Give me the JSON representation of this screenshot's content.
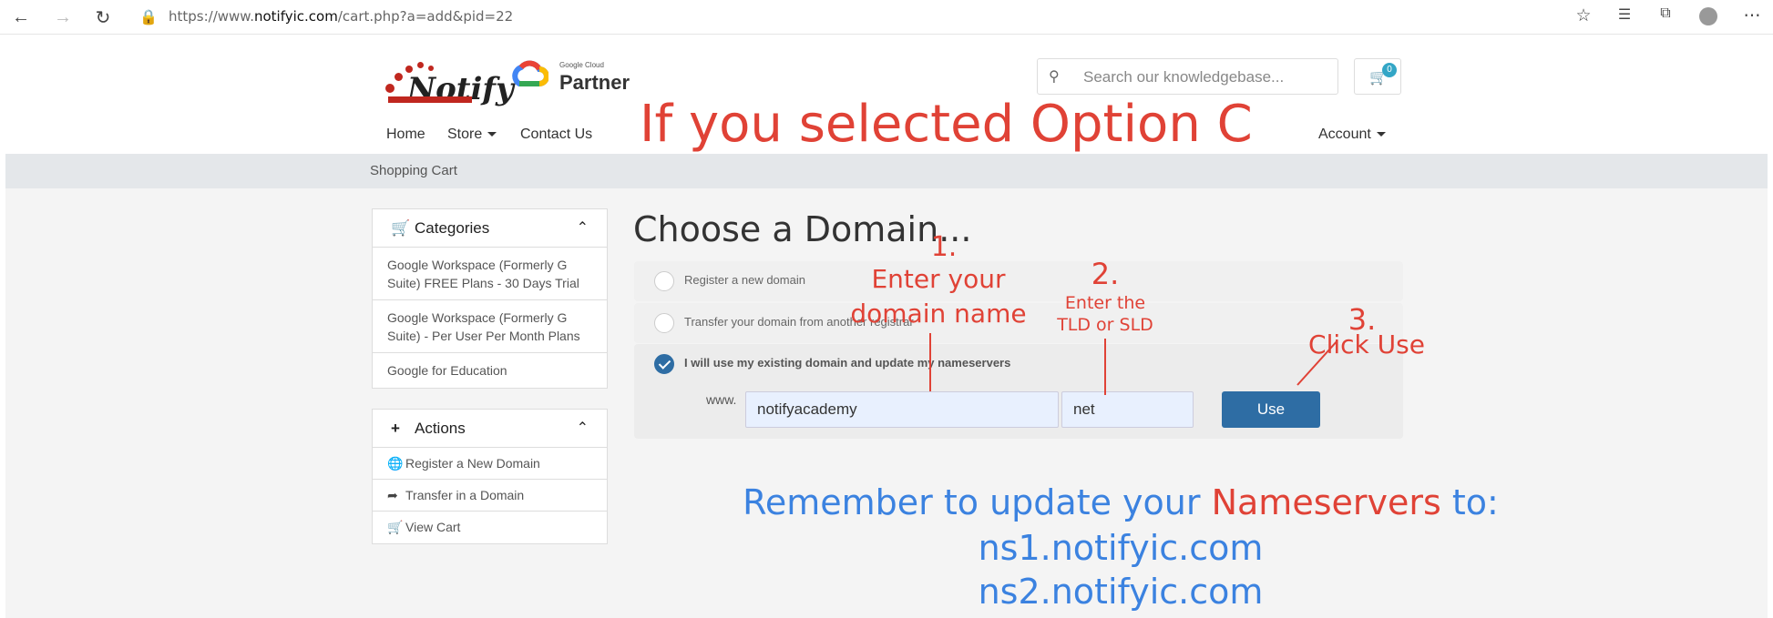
{
  "browser": {
    "url_prefix": "https://www.",
    "url_host": "notifyic.com",
    "url_path": "/cart.php?a=add&pid=22"
  },
  "header": {
    "logo_text": "Notify",
    "google_cloud_label": "Google Cloud",
    "partner_label": "Partner",
    "search_placeholder": "Search our knowledgebase...",
    "cart_count": "0"
  },
  "nav": {
    "home": "Home",
    "store": "Store",
    "contact": "Contact Us",
    "account": "Account"
  },
  "breadcrumb": "Shopping Cart",
  "sidebar": {
    "categories_title": "Categories",
    "categories": [
      "Google Workspace (Formerly G Suite) FREE Plans - 30 Days Trial",
      "Google Workspace (Formerly G Suite) - Per User Per Month Plans",
      "Google for Education"
    ],
    "actions_title": "Actions",
    "actions": [
      "Register a New Domain",
      "Transfer in a Domain",
      "View Cart"
    ]
  },
  "main": {
    "title": "Choose a Domain...",
    "options": [
      "Register a new domain",
      "Transfer your domain from another registrar",
      "I will use my existing domain and update my nameservers"
    ],
    "www_label": "www.",
    "domain_value": "notifyacademy",
    "tld_value": "net",
    "use_button": "Use"
  },
  "annotations": {
    "headline": "If you selected Option C",
    "step1_num": "1.",
    "step1_line1": "Enter your",
    "step1_line2": "domain name",
    "step2_num": "2.",
    "step2_line1": "Enter the",
    "step2_line2": "TLD or SLD",
    "step3_num": "3.",
    "step3_text": "Click Use",
    "remember_prefix": "Remember to update your ",
    "remember_highlight": "Nameservers",
    "remember_suffix": " to:",
    "ns1": "ns1.notifyic.com",
    "ns2": "ns2.notifyic.com"
  },
  "colors": {
    "annotation_red": "#e04236",
    "annotation_blue": "#3b82e0",
    "primary_button": "#2e6da4"
  }
}
